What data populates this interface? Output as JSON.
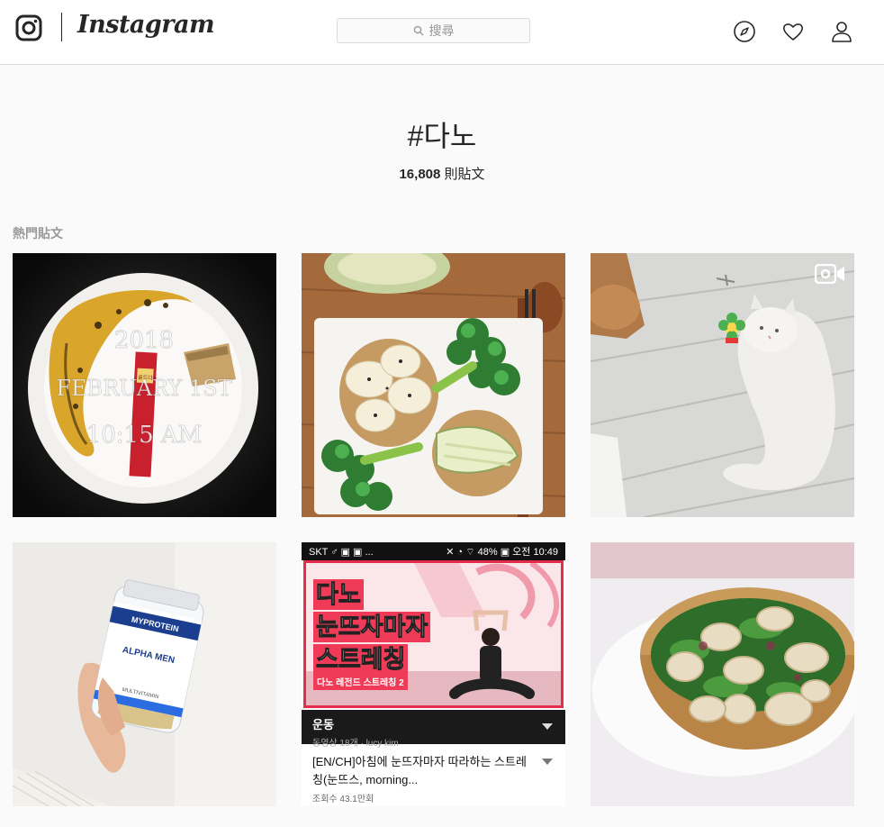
{
  "header": {
    "logo_text": "Instagram",
    "search_placeholder": "搜尋",
    "icons": [
      "instagram-logo-icon",
      "explore-compass-icon",
      "activity-heart-icon",
      "profile-person-icon"
    ]
  },
  "hashtag": {
    "title": "#다노",
    "post_count": "16,808",
    "post_count_suffix": " 則貼文"
  },
  "section": {
    "label": "熱門貼文"
  },
  "posts": [
    {
      "overlay_lines": [
        "2018",
        "FEBRUARY 1ST",
        "10:15 AM"
      ],
      "packet_label": "골드다노"
    },
    {},
    {
      "badge": "video-camera-icon"
    },
    {
      "bottle_brand": "MYPROTEIN",
      "bottle_label": "ALPHA MEN",
      "bottle_small": "MULTIVITAMIN"
    },
    {
      "status_left": "SKT ♂ ▣ ▣ ...",
      "status_right": "✕ ◔ ⌔ 48% ▣ 오전 10:49",
      "headline": [
        "다노",
        "눈뜨자마자",
        "스트레칭"
      ],
      "subtitle": "다노 레전드 스트레칭 2",
      "channel": "운동",
      "channel_meta": "동영상 18개 · lucy kim",
      "video_title": "[EN/CH]아침에 눈뜨자마자 따라하는 스트레칭(눈뜨스, morning...",
      "views": "조회수 43.1만회"
    },
    {}
  ],
  "colors": {
    "border": "#dbdbdb",
    "text": "#262626",
    "muted": "#999999",
    "accent_pink": "#ef3b57"
  }
}
